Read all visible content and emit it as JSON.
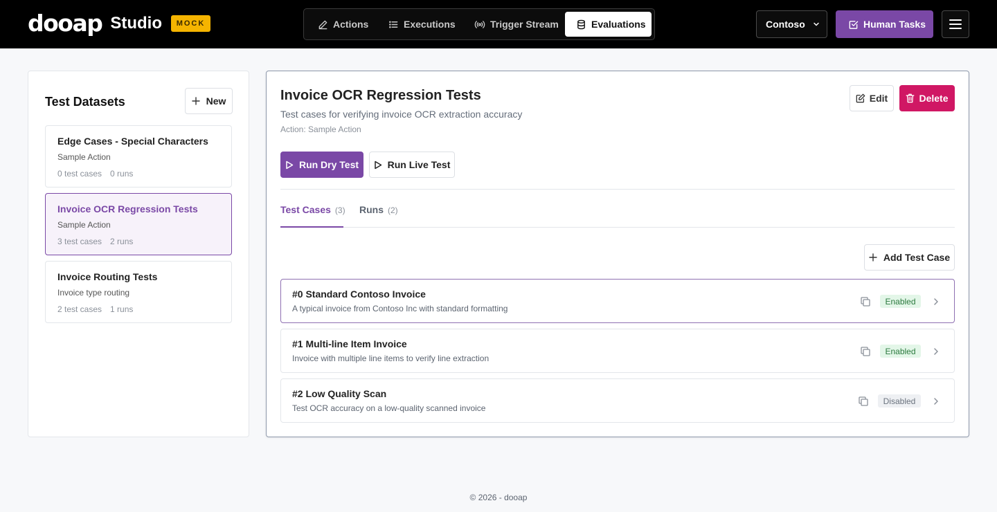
{
  "brand": {
    "logo": "dooap",
    "studio": "Studio",
    "badge": "MOCK"
  },
  "nav": [
    {
      "label": "Actions",
      "icon": "pencil-icon",
      "active": false
    },
    {
      "label": "Executions",
      "icon": "list-icon",
      "active": false
    },
    {
      "label": "Trigger Stream",
      "icon": "broadcast-icon",
      "active": false
    },
    {
      "label": "Evaluations",
      "icon": "database-icon",
      "active": true
    }
  ],
  "header": {
    "org": "Contoso",
    "human_tasks": "Human Tasks"
  },
  "datasets": {
    "title": "Test Datasets",
    "new_label": "New",
    "items": [
      {
        "name": "Edge Cases - Special Characters",
        "action": "Sample Action",
        "cases": "0 test cases",
        "runs": "0 runs",
        "selected": false
      },
      {
        "name": "Invoice OCR Regression Tests",
        "action": "Sample Action",
        "cases": "3 test cases",
        "runs": "2 runs",
        "selected": true
      },
      {
        "name": "Invoice Routing Tests",
        "action": "Invoice type routing",
        "cases": "2 test cases",
        "runs": "1 runs",
        "selected": false
      }
    ]
  },
  "detail": {
    "title": "Invoice OCR Regression Tests",
    "description": "Test cases for verifying invoice OCR extraction accuracy",
    "action": "Action: Sample Action",
    "edit_label": "Edit",
    "delete_label": "Delete",
    "run_dry_label": "Run Dry Test",
    "run_live_label": "Run Live Test",
    "tabs": [
      {
        "label": "Test Cases",
        "count": "(3)",
        "active": true
      },
      {
        "label": "Runs",
        "count": "(2)",
        "active": false
      }
    ],
    "add_label": "Add Test Case",
    "test_cases": [
      {
        "title": "#0 Standard Contoso Invoice",
        "description": "A typical invoice from Contoso Inc with standard formatting",
        "status": "Enabled"
      },
      {
        "title": "#1 Multi-line Item Invoice",
        "description": "Invoice with multiple line items to verify line extraction",
        "status": "Enabled"
      },
      {
        "title": "#2 Low Quality Scan",
        "description": "Test OCR accuracy on a low-quality scanned invoice",
        "status": "Disabled"
      }
    ]
  },
  "footer": "© 2026 - dooap",
  "colors": {
    "brand_purple": "#7a48a6",
    "danger": "#d01764",
    "mock_badge": "#f5b400"
  }
}
